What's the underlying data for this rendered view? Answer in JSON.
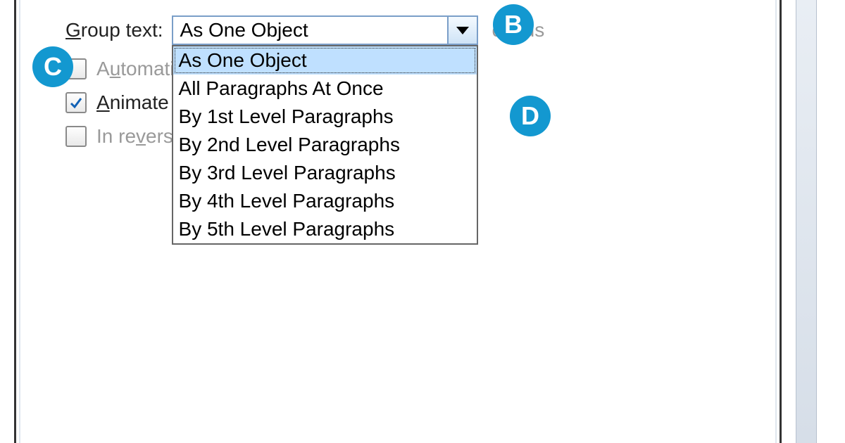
{
  "labels": {
    "group_text": "roup text:",
    "group_text_hot": "G",
    "automatically_pre": "A",
    "automatically_hot": "u",
    "automatically_post": "tomati",
    "seconds_trail": "conds",
    "animate_hot": "A",
    "animate_post": "nimate a",
    "reverse_pre": "In re",
    "reverse_hot": "v",
    "reverse_post": "ers"
  },
  "combo": {
    "selected": "As One Object",
    "options": [
      "As One Object",
      "All Paragraphs At Once",
      "By 1st Level Paragraphs",
      "By 2nd Level Paragraphs",
      "By 3rd Level Paragraphs",
      "By 4th Level Paragraphs",
      "By 5th Level Paragraphs"
    ]
  },
  "checkboxes": {
    "automatically": false,
    "animate": true,
    "reverse": false
  },
  "badges": {
    "b": "B",
    "c": "C",
    "d": "D"
  },
  "colors": {
    "badge": "#1398d0",
    "combo_border": "#7a9ec8",
    "highlight": "#bfe0ff"
  }
}
